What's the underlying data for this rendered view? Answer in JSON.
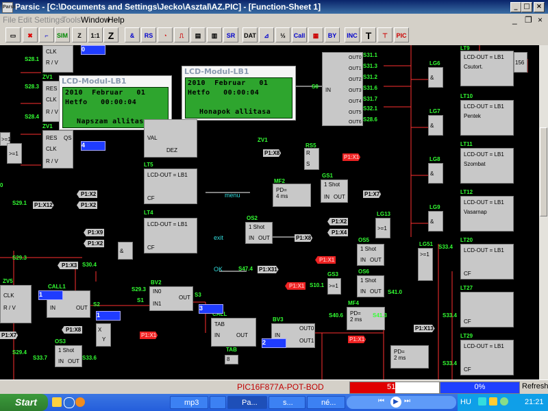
{
  "window": {
    "app_icon_text": "Parsic",
    "title": "Parsic - [C:\\Documents and Settings\\Jecko\\Asztal\\AZ.PIC] - [Function-Sheet 1]",
    "minimize": "_",
    "maximize": "□",
    "close": "×"
  },
  "menu": {
    "items": [
      {
        "label": "File",
        "enabled": false
      },
      {
        "label": "Edit",
        "enabled": false
      },
      {
        "label": "Settings",
        "enabled": false
      },
      {
        "label": "Tools",
        "enabled": false
      },
      {
        "label": "Window",
        "enabled": true
      },
      {
        "label": "Help",
        "enabled": true
      }
    ],
    "right_min": "_",
    "right_restore": "❐",
    "right_close": "×"
  },
  "toolbar": {
    "sim": "SIM",
    "z": "Z",
    "one_to_one": "1:1",
    "z2": "Z",
    "dat": "DAT",
    "inc": "INC",
    "call": "Call",
    "ref": "PIC"
  },
  "lcd_windows": [
    {
      "caption": "LCD-Modul-LB1",
      "rows": [
        "2010  Februar   01",
        "Hetfo   00:00:04",
        "",
        "Napszam allitasa"
      ]
    },
    {
      "caption": "LCD-Modul-LB1",
      "rows": [
        "2010  Februar   01",
        "Hetfo   00:00:04",
        "",
        "Honapok allitasa"
      ]
    }
  ],
  "lcd_blocks": [
    {
      "name": "LT5",
      "header": "LCD-OUT = LB1",
      "cf": "CF"
    },
    {
      "name": "LT4",
      "header": "LCD-OUT = LB1",
      "cf": "CF"
    },
    {
      "name": "",
      "header": "LCD-OUT = LB1",
      "cf": "CF"
    },
    {
      "name": "LT9",
      "header": "LCD-OUT = LB1",
      "sub": "Csutort.",
      "cf": ""
    },
    {
      "name": "LT10",
      "header": "LCD-OUT = LB1",
      "sub": "Pentek",
      "cf": ""
    },
    {
      "name": "LT11",
      "header": "LCD-OUT = LB1",
      "sub": "Szombat",
      "cf": ""
    },
    {
      "name": "LT12",
      "header": "LCD-OUT = LB1",
      "sub": "Vasarnap",
      "cf": ""
    },
    {
      "name": "LT20",
      "header": "LCD-OUT = LB1",
      "cf": "CF"
    },
    {
      "name": "LT27",
      "header": "",
      "cf": "CF"
    },
    {
      "name": "LT29",
      "header": "LCD-OUT = LB1",
      "cf": "CF"
    },
    {
      "name": "LT17",
      "header": "LCD-OUT = LB1",
      "cf": ""
    }
  ],
  "signals": {
    "menu": "menu",
    "exit": "exit",
    "ok": "OK",
    "p1x8": "P1:X8",
    "p1x7": "P1:X7",
    "p1x2": "P1:X2",
    "p1x4": "P1:X4",
    "p1x3": "P1:X3",
    "p1x12": "P1:X12",
    "p1x9": "P1:X9",
    "p1x31": "P1:X31",
    "p1x13": "P1:X13",
    "p1x1": "P1:X1",
    "mf2": "MF2",
    "mf4": "MF4",
    "pd4": "PD=\n4 ms",
    "pd2": "PD=\n2 ms",
    "oneshot": "1 Shot",
    "in": "IN",
    "out": "OUT",
    "bv2": "BV2",
    "bv3": "BV3",
    "in0": "IN0",
    "in1": "IN1",
    "out0": "OUT0",
    "out1": "OUT1",
    "tab": "TAB",
    "call": "CALL",
    "call1": "CALL1",
    "rs": "RS5",
    "r": "R",
    "s": "S",
    "q": "Q",
    "x": "X",
    "y": "Y",
    "gs1": "GS1",
    "gs3": "GS3",
    "gs6": "GS6",
    "gs5": "GS5",
    "os2": "OS2",
    "os3": "OS3",
    "os5": "OS5",
    "os6": "OS6",
    "lg6": "LG6",
    "lg7": "LG7",
    "lg8": "LG8",
    "lg9": "LG9",
    "lg13": "LG13",
    "lg51": "LG51",
    "zv1": "ZV1",
    "zv5": "ZV5",
    "dez": "DEZ",
    "val": "VAL",
    "s0": "S0",
    "s1": "S1",
    "s2": "S2",
    "s3": "S3",
    "s8": "S8",
    "v1": "1",
    "v2": "2",
    "v3": "3",
    "v4": "4",
    "v0": "0",
    "v156": "156",
    "v8": "8",
    "res": "RES",
    "clk": "CLK",
    "rv": "R / V",
    "qs": "QS",
    "ge1": ">=1",
    "amp": "&"
  },
  "status": {
    "device": "PIC16F877A-POT-BOD",
    "progress1_value": 51,
    "progress1_text": "51%",
    "progress2_value": 0,
    "progress2_text": "0%",
    "refresh": "Refresh"
  },
  "taskbar": {
    "start": "Start",
    "tasks": [
      "mp3",
      "",
      "Pa...",
      "s...",
      "né..."
    ],
    "lang": "HU",
    "clock": "21:21"
  }
}
